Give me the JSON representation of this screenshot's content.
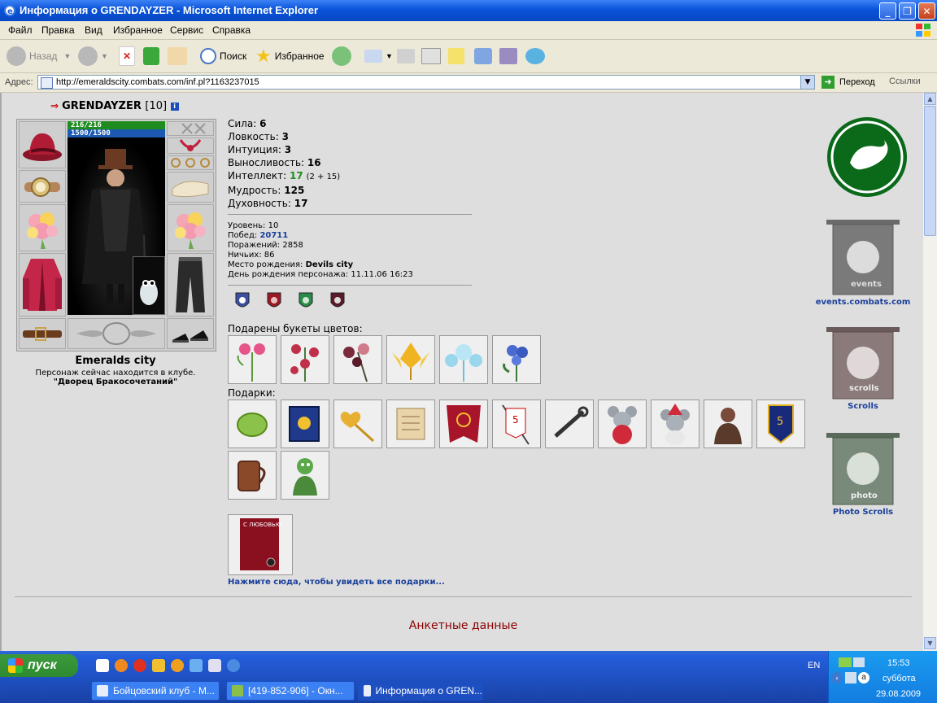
{
  "window": {
    "title": "Информация о GRENDAYZER - Microsoft Internet Explorer"
  },
  "menu": [
    "Файл",
    "Правка",
    "Вид",
    "Избранное",
    "Сервис",
    "Справка"
  ],
  "toolbar": {
    "back": "Назад",
    "search": "Поиск",
    "favorites": "Избранное"
  },
  "address": {
    "label": "Адрес:",
    "url": "http://emeraldscity.combats.com/inf.pl?1163237015",
    "go": "Переход",
    "links": "Ссылки"
  },
  "character": {
    "name": "GRENDAYZER",
    "level": "[10]",
    "hp": "216/216",
    "mana": "1500/1500",
    "city": "Emeralds city",
    "club_text": "Персонаж сейчас находится в клубе.",
    "club_location": "\"Дворец Бракосочетаний\""
  },
  "stats": [
    {
      "label": "Сила:",
      "value": "6"
    },
    {
      "label": "Ловкость:",
      "value": "3"
    },
    {
      "label": "Интуиция:",
      "value": "3"
    },
    {
      "label": "Выносливость:",
      "value": "16"
    },
    {
      "label": "Интеллект:",
      "value": "17",
      "extra": "(2 + 15)"
    },
    {
      "label": "Мудрость:",
      "value": "125"
    },
    {
      "label": "Духовность:",
      "value": "17"
    }
  ],
  "info": {
    "level": {
      "label": "Уровень:",
      "value": "10"
    },
    "wins": {
      "label": "Побед:",
      "value": "20711"
    },
    "losses": {
      "label": "Поражений:",
      "value": "2858"
    },
    "draws": {
      "label": "Ничьих:",
      "value": "86"
    },
    "birthplace": {
      "label": "Место рождения:",
      "value": "Devils city"
    },
    "birthday": {
      "label": "День рождения персонажа:",
      "value": "11.11.06 16:23"
    }
  },
  "flowers_heading": "Подарены букеты цветов:",
  "gifts_heading": "Подарки:",
  "all_gifts_link": "Нажмите сюда, чтобы увидеть все подарки...",
  "anketa": "Анкетные данные",
  "sidebar": {
    "events": "events.combats.com",
    "events_banner": "events",
    "scrolls": "Scrolls",
    "scrolls_banner": "scrolls",
    "photo": "Photo Scrolls",
    "photo_banner": "photo"
  },
  "taskbar": {
    "start": "пуск",
    "tasks": [
      "Бойцовский клуб - М...",
      "[419-852-906] - Окн...",
      "Информация о GREN..."
    ],
    "lang": "EN",
    "time": "15:53",
    "day": "суббота",
    "date": "29.08.2009"
  },
  "colors": {
    "titlebar": "#0a53d9",
    "content_bg": "#dedede",
    "link": "#1a3f9a",
    "anketa": "#8b0000",
    "hp_bar": "#1e8c1e",
    "mana_bar": "#1c59b2"
  }
}
